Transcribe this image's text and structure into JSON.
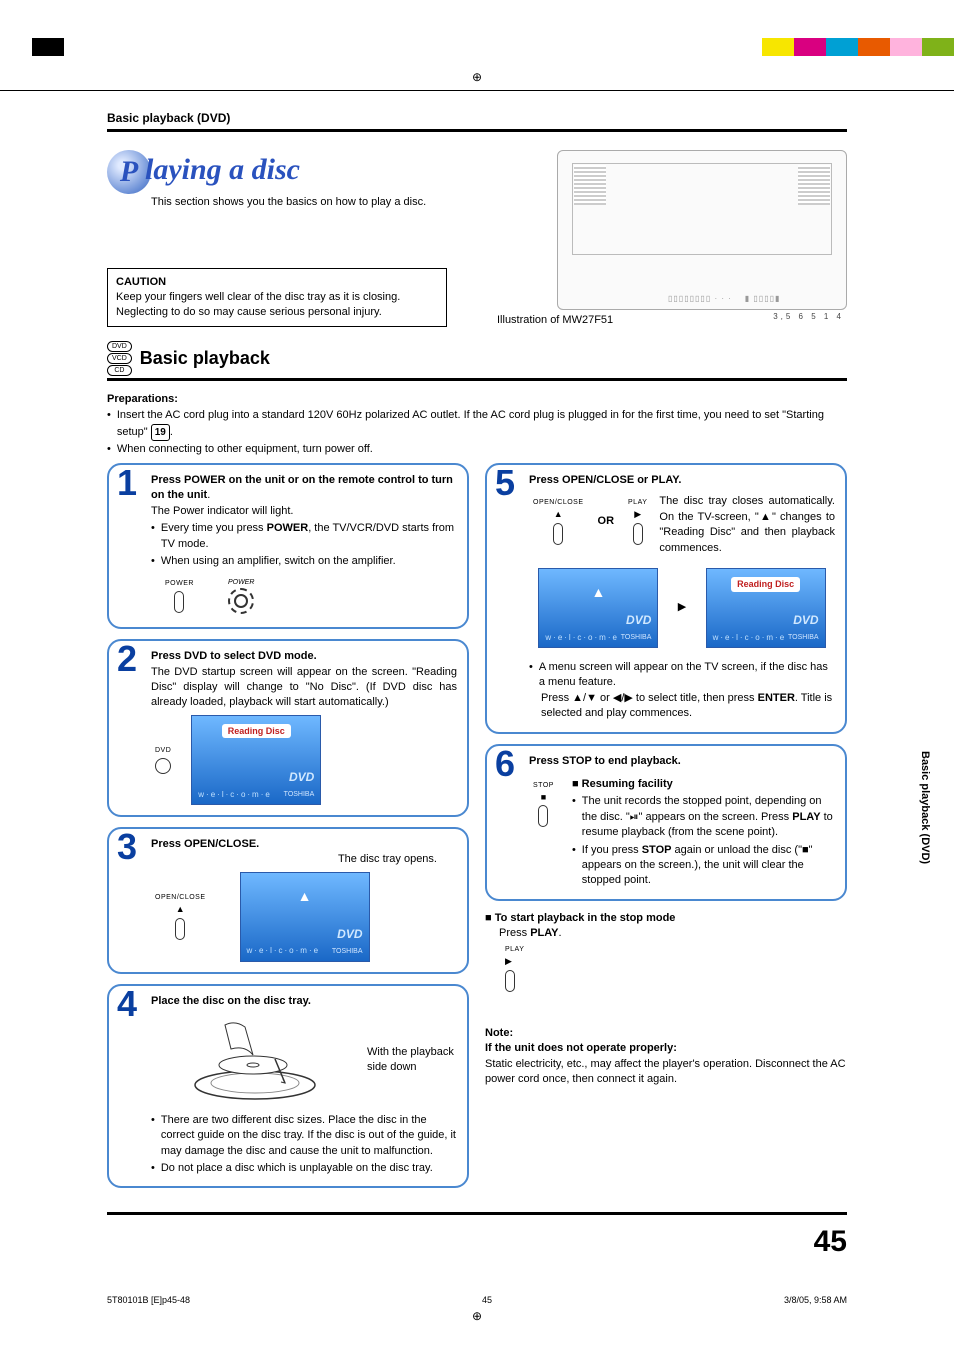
{
  "header_label": "Basic playback (DVD)",
  "section": {
    "title_first_letter": "P",
    "title_rest": "laying a disc",
    "subtitle": "This section shows you the basics on how to play a disc."
  },
  "caution": {
    "title": "CAUTION",
    "body": "Keep your fingers well clear of the disc tray as it is closing. Neglecting to do so may cause serious personal injury."
  },
  "illustration": {
    "caption": "Illustration of MW27F51",
    "ticks": "3,5   6 5  1  4"
  },
  "media_icons": [
    "DVD",
    "VCD",
    "CD"
  ],
  "subhead": "Basic playback",
  "prep": {
    "label": "Preparations:",
    "line1a": "Insert the AC cord plug into a standard 120V 60Hz polarized AC outlet. If the AC cord plug is plugged in for the first time, you need to set \"Starting setup\" ",
    "page_ref": "19",
    "line1b": ".",
    "line2": "When connecting to other equipment, turn power off."
  },
  "steps": {
    "s1": {
      "num": "1",
      "title": "Press POWER on the unit or on the remote control to turn on the unit",
      "title_period": ".",
      "line1": "The Power indicator will light.",
      "bullet1a": "Every time you press ",
      "bullet1_strong": "POWER",
      "bullet1b": ", the TV/VCR/DVD starts from TV mode.",
      "bullet2": "When using an amplifier, switch on the amplifier.",
      "btn_power": "POWER"
    },
    "s2": {
      "num": "2",
      "title": "Press DVD to select DVD mode.",
      "body": "The DVD startup screen will appear on the screen. \"Reading Disc\" display will change to \"No Disc\". (If DVD disc has already loaded, playback will start automatically.)",
      "btn_dvd": "DVD",
      "screen_msg": "Reading Disc",
      "screen_dvd": "DVD",
      "screen_brand": "TOSHIBA",
      "screen_welcome": "w·e·l·c·o·m·e"
    },
    "s3": {
      "num": "3",
      "title": "Press OPEN/CLOSE.",
      "body": "The disc tray opens.",
      "btn_open": "OPEN/CLOSE",
      "eject_sym": "▲"
    },
    "s4": {
      "num": "4",
      "title": "Place the disc on the disc tray.",
      "side_text": "With the playback side down",
      "bullet1": "There are two different disc sizes. Place the disc in the correct guide on the disc tray. If the disc is out of the guide, it may damage the disc and cause the unit to malfunction.",
      "bullet2": "Do not place a disc which is unplayable on the disc tray."
    },
    "s5": {
      "num": "5",
      "title": "Press OPEN/CLOSE or PLAY.",
      "btn_open": "OPEN/CLOSE",
      "btn_play": "PLAY",
      "or": "OR",
      "body": "The disc tray closes automatically. On the TV-screen, \"▲\" changes to \"Reading Disc\" and then playback commences.",
      "screen_msg": "Reading Disc",
      "menu1": "A menu screen will appear on the TV screen, if the disc has a menu feature.",
      "menu2a": "Press ▲/▼ or ◀/▶ to select title, then press ",
      "menu2_strong": "ENTER",
      "menu2b": ". Title is selected and play commences."
    },
    "s6": {
      "num": "6",
      "title": "Press STOP to end playback.",
      "btn_stop": "STOP",
      "resume_title": "Resuming facility",
      "bullet1a": "The unit records the stopped point, depending on the disc. \"⏯\" appears on the screen. Press ",
      "bullet1_strong": "PLAY",
      "bullet1b": " to resume playback (from the scene point).",
      "bullet2a": "If you press ",
      "bullet2_strong1": "STOP",
      "bullet2b": " again or unload the disc (\"■\" appears on the screen.), the unit will clear the stopped point."
    }
  },
  "after_steps": {
    "start_title": "To start playback in the stop mode",
    "start_body_a": "Press ",
    "start_body_strong": "PLAY",
    "start_body_b": ".",
    "btn_play": "PLAY",
    "note_label": "Note:",
    "note_title": "If the unit does not operate properly:",
    "note_body": "Static electricity, etc., may affect the player's operation. Disconnect the AC power cord once, then connect it again."
  },
  "side_tab": "Basic playback (DVD)",
  "page_number": "45",
  "footer": {
    "doc_id": "5T80101B [E]p45-48",
    "page": "45",
    "timestamp": "3/8/05, 9:58 AM"
  },
  "top_colors_left": [
    "#ffffff",
    "#000000",
    "#ffffff",
    "#ffffff",
    "#ffffff",
    "#ffffff"
  ],
  "top_colors_right": [
    "#f7e600",
    "#d90080",
    "#00a0d4",
    "#e85a00",
    "#ffb3dd",
    "#7fb219"
  ]
}
